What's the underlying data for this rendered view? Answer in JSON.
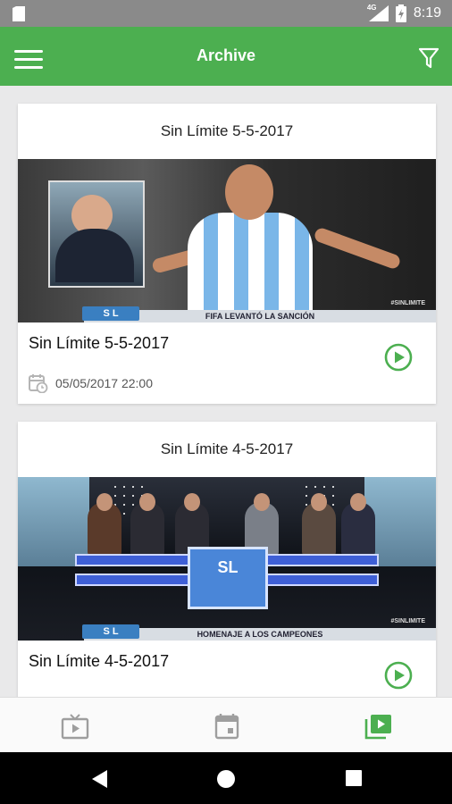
{
  "status_bar": {
    "time": "8:19",
    "network": "4G"
  },
  "app_bar": {
    "title": "Archive"
  },
  "cards": [
    {
      "header": "Sin Límite 5-5-2017",
      "title": "Sin Límite 5-5-2017",
      "date": "05/05/2017 22:00",
      "thumb_logo": "S L",
      "thumb_hashtag": "#SINLIMITE",
      "thumb_caption": "FIFA LEVANTÓ LA SANCIÓN"
    },
    {
      "header": "Sin Límite 4-5-2017",
      "title": "Sin Límite 4-5-2017",
      "thumb_logo": "S L",
      "thumb_hashtag": "#SINLIMITE",
      "thumb_caption": "HOMENAJE A LOS CAMPEONES",
      "screen_logo": "SL"
    }
  ],
  "bottom_nav": {
    "tabs": [
      {
        "icon": "tv-icon",
        "active": false
      },
      {
        "icon": "calendar-icon",
        "active": false
      },
      {
        "icon": "video-library-icon",
        "active": true
      }
    ]
  },
  "colors": {
    "accent": "#4caf50",
    "inactive": "#9e9e9e"
  }
}
